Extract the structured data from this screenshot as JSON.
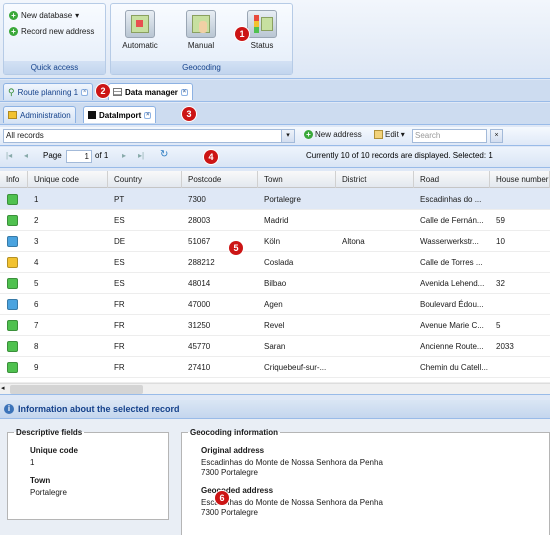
{
  "ribbon": {
    "quick_access": {
      "caption": "Quick access",
      "new_database": "New database",
      "record_new_address": "Record new address"
    },
    "geocoding": {
      "caption": "Geocoding",
      "automatic": "Automatic",
      "manual": "Manual",
      "status": "Status"
    }
  },
  "badges": [
    "1",
    "2",
    "3",
    "4",
    "5",
    "6"
  ],
  "main_tabs": [
    {
      "label": "Route planning 1"
    },
    {
      "label": "Data manager"
    }
  ],
  "sub_tabs": [
    {
      "label": "Administration"
    },
    {
      "label": "DataImport"
    }
  ],
  "toolbar": {
    "filter_value": "All records",
    "new_address": "New address",
    "edit": "Edit",
    "search_placeholder": "Search"
  },
  "pager": {
    "page_label": "Page",
    "page_value": "1",
    "of_label": "of 1",
    "status": "Currently 10 of 10 records are displayed. Selected: 1"
  },
  "grid": {
    "columns": [
      "Info",
      "Unique code",
      "Country",
      "Postcode",
      "Town",
      "District",
      "Road",
      "House number"
    ],
    "status_colors": {
      "green": "#4fc14f",
      "blue": "#4aa3df",
      "yellow": "#f2c230"
    },
    "rows": [
      {
        "status": "green",
        "code": "1",
        "country": "PT",
        "postcode": "7300",
        "town": "Portalegre",
        "district": "",
        "road": "Escadinhas do ...",
        "house": ""
      },
      {
        "status": "green",
        "code": "2",
        "country": "ES",
        "postcode": "28003",
        "town": "Madrid",
        "district": "",
        "road": "Calle de Fernán...",
        "house": "59"
      },
      {
        "status": "blue",
        "code": "3",
        "country": "DE",
        "postcode": "51067",
        "town": "Köln",
        "district": "Altona",
        "road": "Wasserwerkstr...",
        "house": "10"
      },
      {
        "status": "yellow",
        "code": "4",
        "country": "ES",
        "postcode": "288212",
        "town": "Coslada",
        "district": "",
        "road": "Calle de Torres ...",
        "house": ""
      },
      {
        "status": "green",
        "code": "5",
        "country": "ES",
        "postcode": "48014",
        "town": "Bilbao",
        "district": "",
        "road": "Avenida Lehend...",
        "house": "32"
      },
      {
        "status": "blue",
        "code": "6",
        "country": "FR",
        "postcode": "47000",
        "town": "Agen",
        "district": "",
        "road": "Boulevard Édou...",
        "house": ""
      },
      {
        "status": "green",
        "code": "7",
        "country": "FR",
        "postcode": "31250",
        "town": "Revel",
        "district": "",
        "road": "Avenue Marie C...",
        "house": "5"
      },
      {
        "status": "green",
        "code": "8",
        "country": "FR",
        "postcode": "45770",
        "town": "Saran",
        "district": "",
        "road": "Ancienne Route...",
        "house": "2033"
      },
      {
        "status": "green",
        "code": "9",
        "country": "FR",
        "postcode": "27410",
        "town": "Criquebeuf-sur-...",
        "district": "",
        "road": "Chemin du Catell...",
        "house": ""
      }
    ]
  },
  "info_panel": {
    "title": "Information about the selected record",
    "descriptive": {
      "legend": "Descriptive fields",
      "unique_code_label": "Unique code",
      "unique_code_value": "1",
      "town_label": "Town",
      "town_value": "Portalegre"
    },
    "geocoding": {
      "legend": "Geocoding information",
      "original_label": "Original address",
      "original_line1": "Escadinhas do Monte de Nossa Senhora da Penha",
      "original_line2": "7300 Portalegre",
      "geocoded_label": "Geocoded address",
      "geocoded_line1": "Escadinhas do Monte de Nossa Senhora da Penha",
      "geocoded_line2": "7300 Portalegre"
    }
  }
}
